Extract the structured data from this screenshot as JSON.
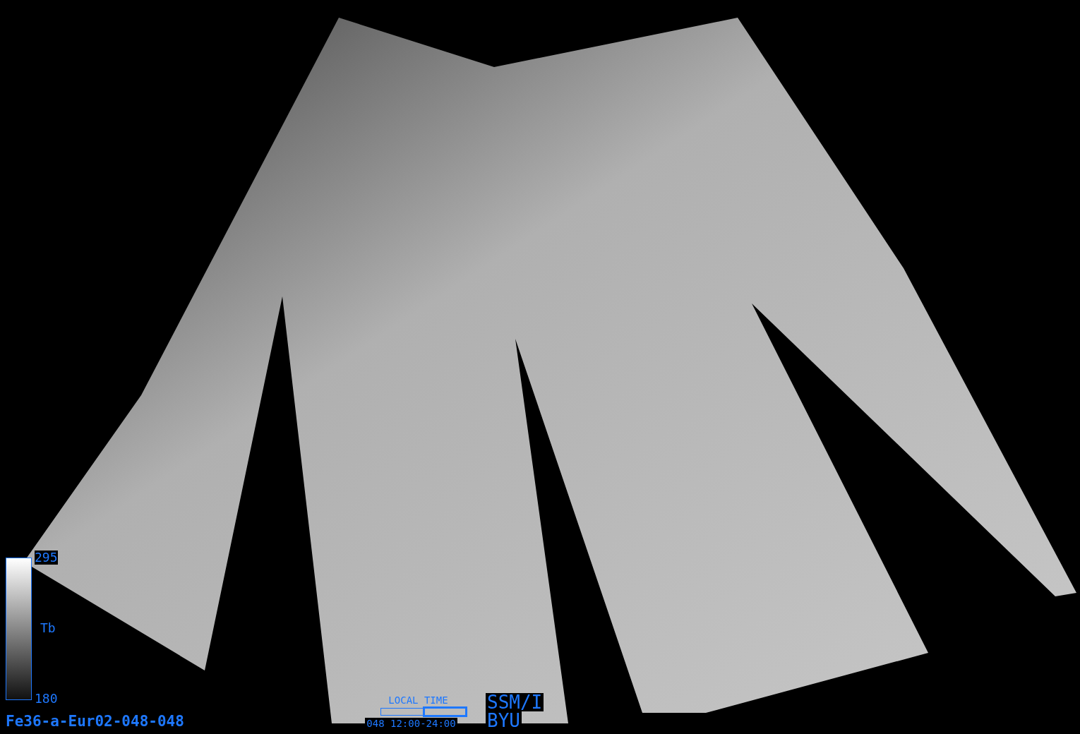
{
  "color_bar": {
    "max_label": "295",
    "variable_label": "Tb",
    "min_label": "180"
  },
  "image_id": "Fe36-a-Eur02-048-048",
  "local_time": {
    "label": "LOCAL TIME",
    "range": "048 12:00-24:00"
  },
  "sensor": {
    "name": "SSM/I",
    "source": "BYU"
  }
}
